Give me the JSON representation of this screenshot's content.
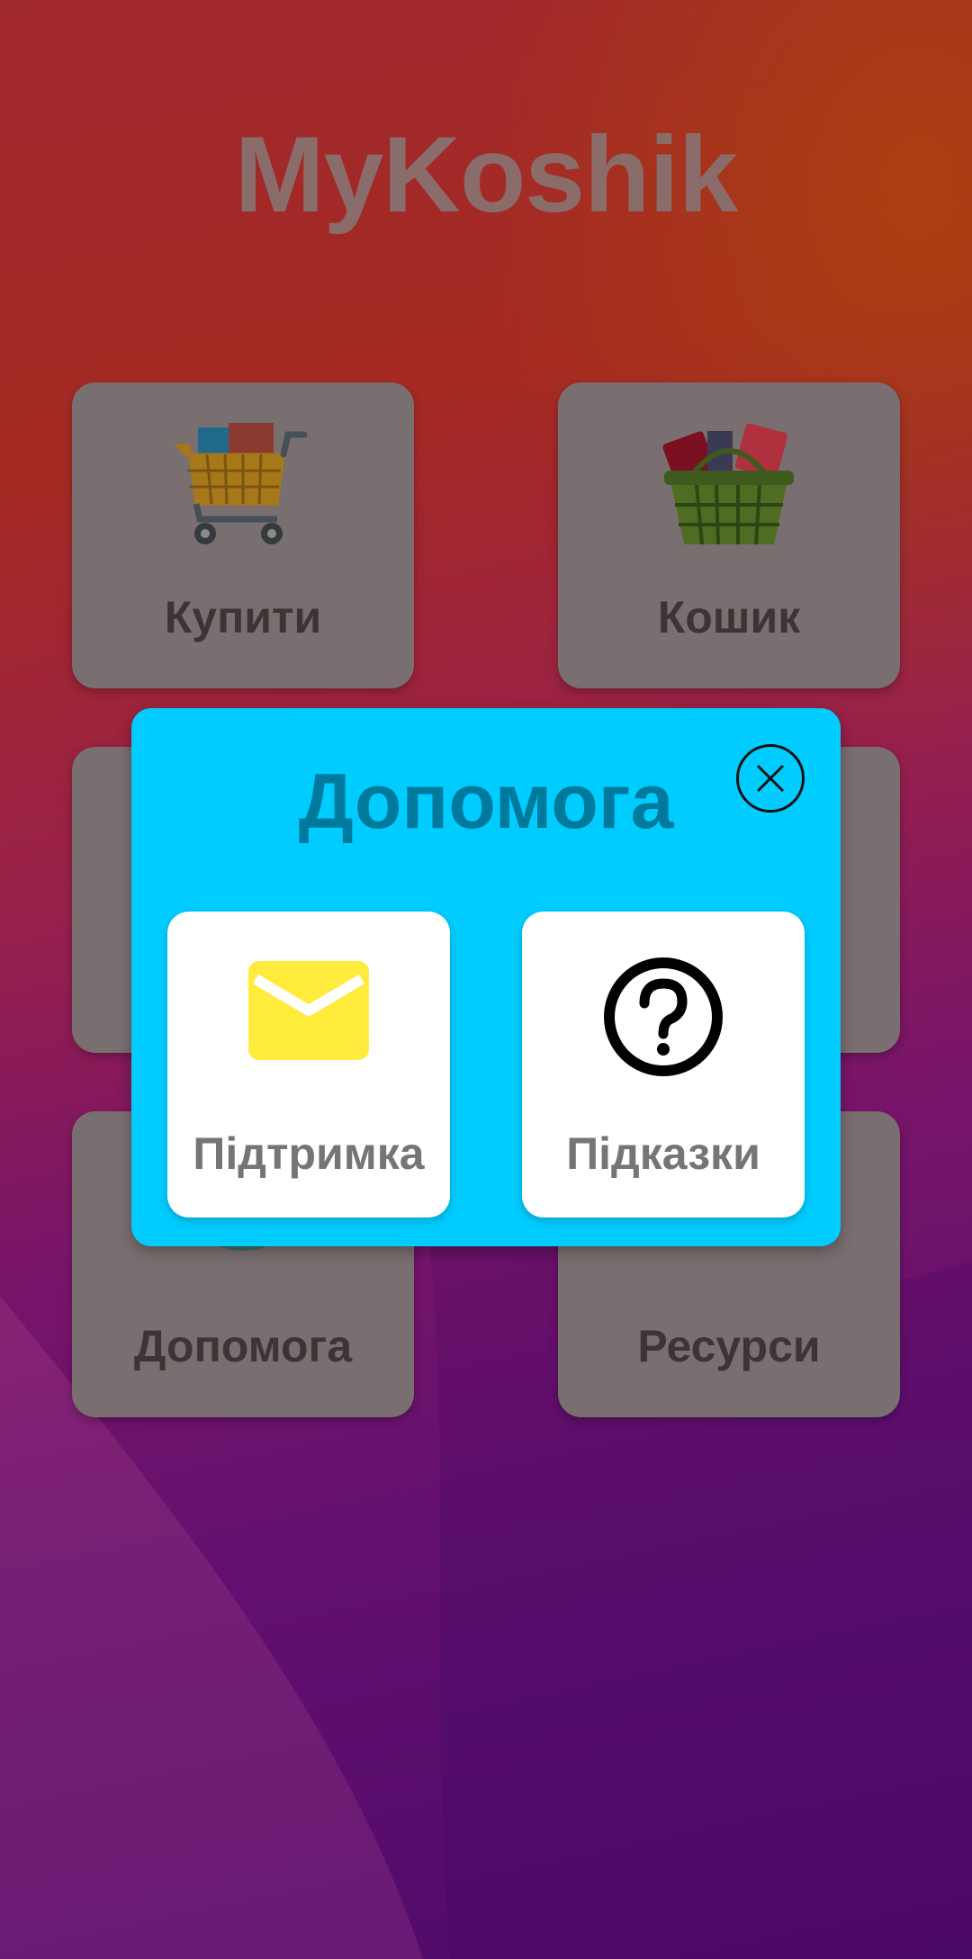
{
  "app": {
    "title": "MyKoshik"
  },
  "tiles": [
    {
      "label": "Купити",
      "icon": "shopping-cart-icon"
    },
    {
      "label": "Кошик",
      "icon": "basket-icon"
    },
    {
      "label": "Допомога",
      "icon": "gear-icon"
    },
    {
      "label": "Ресурси",
      "icon": "resources-icon"
    }
  ],
  "dialog": {
    "title": "Допомога",
    "close_icon": "close-icon",
    "options": [
      {
        "label": "Підтримка",
        "icon": "mail-icon"
      },
      {
        "label": "Підказки",
        "icon": "help-circle-icon"
      }
    ]
  },
  "colors": {
    "dialog_bg": "#00ccff",
    "dialog_title": "#007a9c",
    "mail_icon": "#ffeb3b",
    "option_label": "#757575"
  }
}
